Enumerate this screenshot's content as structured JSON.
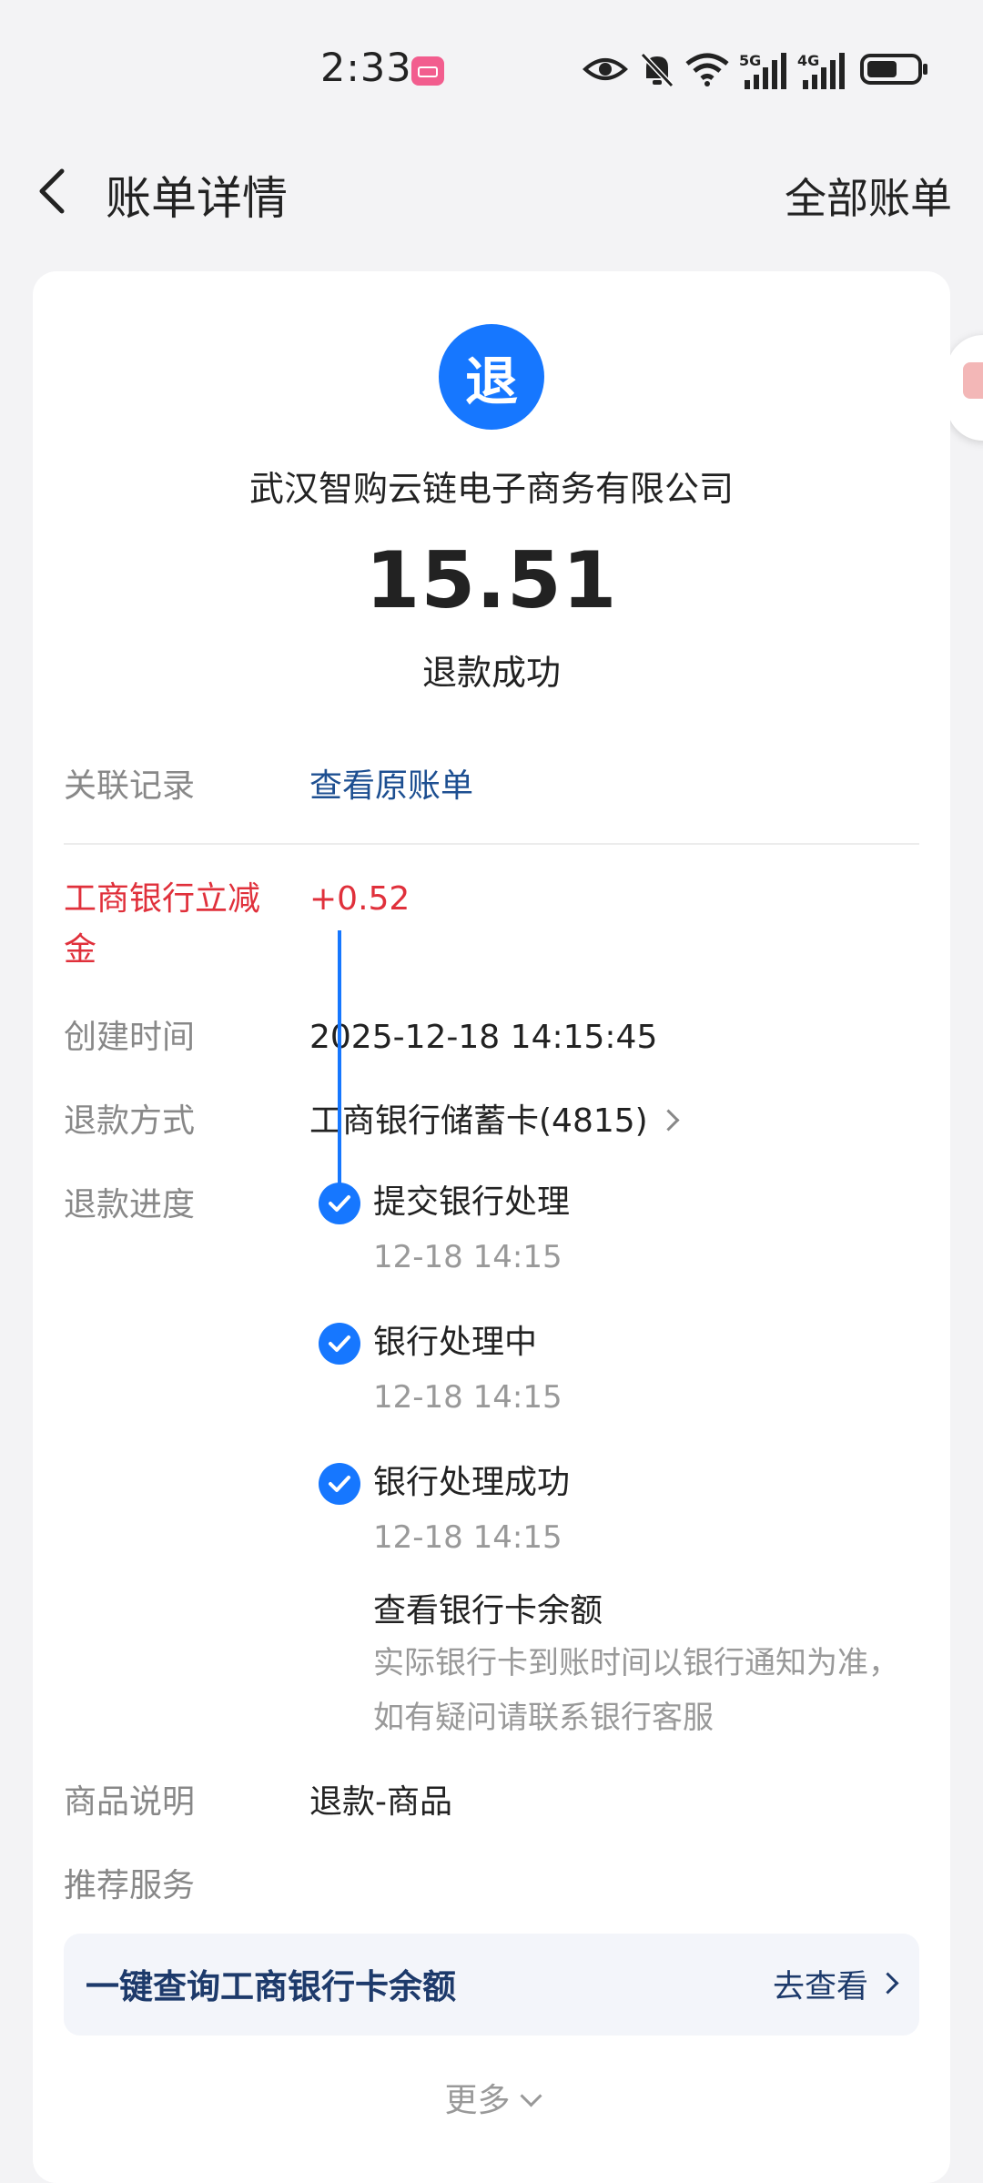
{
  "status_bar": {
    "time": "2:33",
    "network_5g": "5G",
    "network_4g": "4G"
  },
  "nav": {
    "title": "账单详情",
    "right_action": "全部账单"
  },
  "header": {
    "logo_char": "退",
    "merchant": "武汉智购云链电子商务有限公司",
    "amount": "15.51",
    "status": "退款成功"
  },
  "details": {
    "related_label": "关联记录",
    "related_value": "查看原账单",
    "discount_label": "工商银行立减金",
    "discount_value": "+0.52",
    "created_label": "创建时间",
    "created_value": "2025-12-18 14:15:45",
    "method_label": "退款方式",
    "method_value": "工商银行储蓄卡(4815)",
    "progress_label": "退款进度",
    "product_label": "商品说明",
    "product_value": "退款-商品",
    "recommend_label": "推荐服务"
  },
  "progress": [
    {
      "title": "提交银行处理",
      "time": "12-18 14:15"
    },
    {
      "title": "银行处理中",
      "time": "12-18 14:15"
    },
    {
      "title": "银行处理成功",
      "time": "12-18 14:15"
    }
  ],
  "bank_link": "查看银行卡余额",
  "note_line1": "实际银行卡到账时间以银行通知为准，",
  "note_line2": "如有疑问请联系银行客服",
  "service": {
    "label": "一键查询工商银行卡余额",
    "action": "去查看"
  },
  "more": "更多",
  "colors": {
    "accent": "#1677ff",
    "link": "#1d4f91",
    "red": "#e0303b"
  }
}
